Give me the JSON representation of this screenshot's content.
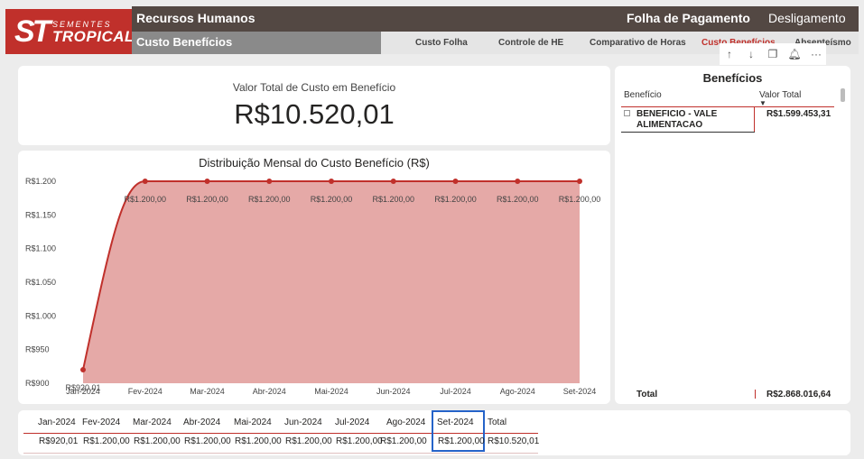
{
  "brand": {
    "name": "TROPICAL",
    "sub": "SEMENTES",
    "mark": "ST",
    "color": "#c0302b"
  },
  "header": {
    "title": "Recursos Humanos",
    "nav": [
      "Folha de Pagamento",
      "Desligamento"
    ]
  },
  "subheader": {
    "title": "Custo Benefícios"
  },
  "tabs": [
    {
      "label": "Custo Folha",
      "active": false
    },
    {
      "label": "Controle de HE",
      "active": false
    },
    {
      "label": "Comparativo de Horas",
      "active": false
    },
    {
      "label": "Custo Benefícios",
      "active": true
    },
    {
      "label": "Absenteísmo",
      "active": false
    }
  ],
  "toolbar_icons": [
    "arrow-up-icon",
    "arrow-down-icon",
    "copy-icon",
    "bell-icon",
    "more-icon"
  ],
  "kpi": {
    "label": "Valor Total de Custo em Benefício",
    "value": "R$10.520,01"
  },
  "chart_data": {
    "type": "area",
    "title": "Distribuição Mensal do Custo Benefício (R$)",
    "x": [
      "Jan-2024",
      "Fev-2024",
      "Mar-2024",
      "Abr-2024",
      "Mai-2024",
      "Jun-2024",
      "Jul-2024",
      "Ago-2024",
      "Set-2024"
    ],
    "values": [
      920.01,
      1200,
      1200,
      1200,
      1200,
      1200,
      1200,
      1200,
      1200
    ],
    "labels": [
      "R$920,01",
      "R$1.200,00",
      "R$1.200,00",
      "R$1.200,00",
      "R$1.200,00",
      "R$1.200,00",
      "R$1.200,00",
      "R$1.200,00",
      "R$1.200,00"
    ],
    "yticks": [
      "R$900",
      "R$950",
      "R$1.000",
      "R$1.050",
      "R$1.100",
      "R$1.150",
      "R$1.200"
    ],
    "ylim": [
      900,
      1200
    ],
    "fill_color": "#e5a9a7",
    "line_color": "#c0302b"
  },
  "benefits": {
    "title": "Benefícios",
    "col1": "Benefício",
    "col2": "Valor Total",
    "row": {
      "label": "BENEFICIO - VALE ALIMENTACAO",
      "value": "R$1.599.453,31"
    },
    "total_label": "Total",
    "total_value": "R$2.868.016,64"
  },
  "monthly_table": {
    "headers": [
      "Jan-2024",
      "Fev-2024",
      "Mar-2024",
      "Abr-2024",
      "Mai-2024",
      "Jun-2024",
      "Jul-2024",
      "Ago-2024",
      "Set-2024",
      "Total"
    ],
    "values": [
      "R$920,01",
      "R$1.200,00",
      "R$1.200,00",
      "R$1.200,00",
      "R$1.200,00",
      "R$1.200,00",
      "R$1.200,00",
      "R$1.200,00",
      "R$1.200,00",
      "R$10.520,01"
    ]
  }
}
